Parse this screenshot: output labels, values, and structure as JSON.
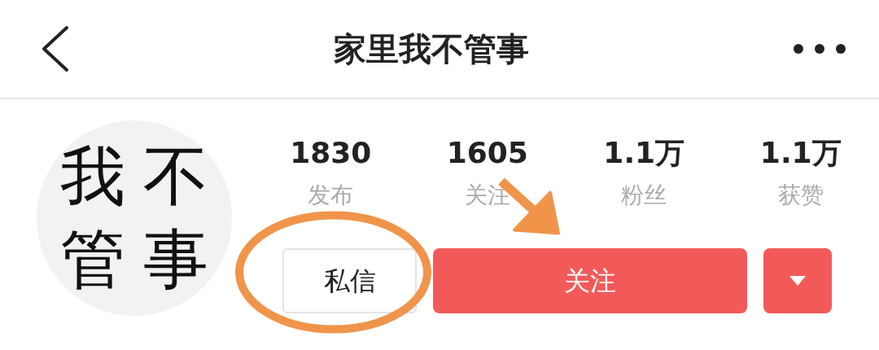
{
  "header": {
    "title": "家里我不管事"
  },
  "avatar": {
    "characters": [
      "我",
      "不",
      "管",
      "事"
    ]
  },
  "stats": [
    {
      "value": "1830",
      "label": "发布"
    },
    {
      "value": "1605",
      "label": "关注"
    },
    {
      "value": "1.1万",
      "label": "粉丝"
    },
    {
      "value": "1.1万",
      "label": "获赞"
    }
  ],
  "buttons": [
    {
      "kind": "message",
      "label": "私信",
      "circled": true,
      "arrow_pointing": false
    },
    {
      "kind": "follow",
      "label": "关注",
      "circled": false,
      "arrow_pointing": true
    },
    {
      "kind": "dropdown",
      "circled": false,
      "arrow_pointing": false
    }
  ]
}
